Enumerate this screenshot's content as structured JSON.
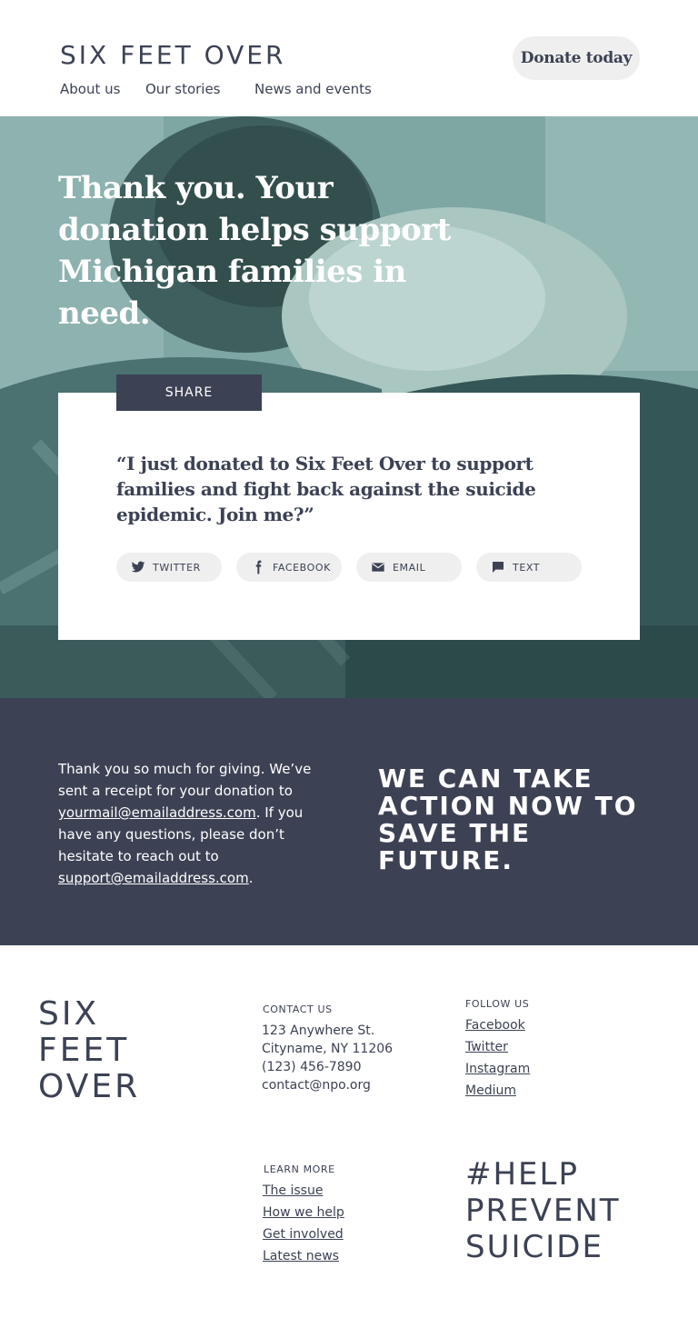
{
  "header": {
    "logo": "SIX FEET OVER",
    "nav": [
      "About us",
      "Our stories",
      "News and events"
    ],
    "donate_label": "Donate today"
  },
  "hero": {
    "title": "Thank you. Your donation helps support Michigan families in need.",
    "share_tab": "SHARE",
    "quote": "“I just donated to Six Feet Over to support families and fight back against the suicide epidemic. Join me?”",
    "share_buttons": [
      {
        "label": "TWITTER",
        "icon": "twitter-icon"
      },
      {
        "label": "FACEBOOK",
        "icon": "facebook-icon"
      },
      {
        "label": "EMAIL",
        "icon": "email-icon"
      },
      {
        "label": "TEXT",
        "icon": "text-icon"
      }
    ]
  },
  "band": {
    "text_part1": "Thank you so much for giving. We’ve sent a receipt for your donation to ",
    "receipt_email": "yourmail@emailaddress.com",
    "text_part2": ". If you have any questions, please don’t hesitate to reach out to ",
    "support_email": "support@emailaddress.com",
    "text_part3": ".",
    "slogan": "WE CAN TAKE ACTION NOW TO SAVE THE FUTURE."
  },
  "footer": {
    "logo_lines": [
      "SIX",
      "FEET",
      "OVER"
    ],
    "contact": {
      "title": "CONTACT US",
      "lines": [
        "123 Anywhere St.",
        "Cityname, NY 11206",
        "(123) 456-7890",
        "contact@npo.org"
      ]
    },
    "follow": {
      "title": "FOLLOW US",
      "links": [
        "Facebook",
        "Twitter",
        "Instagram",
        "Medium"
      ]
    },
    "learn": {
      "title": "LEARN MORE",
      "links": [
        "The issue",
        "How we help",
        "Get involved",
        "Latest news"
      ]
    },
    "hashtag_lines": [
      "#HELP",
      "PREVENT",
      "SUICIDE"
    ]
  },
  "colors": {
    "navy": "#3c4254",
    "hero_teal": "#6f9896",
    "pill": "#efefef"
  }
}
